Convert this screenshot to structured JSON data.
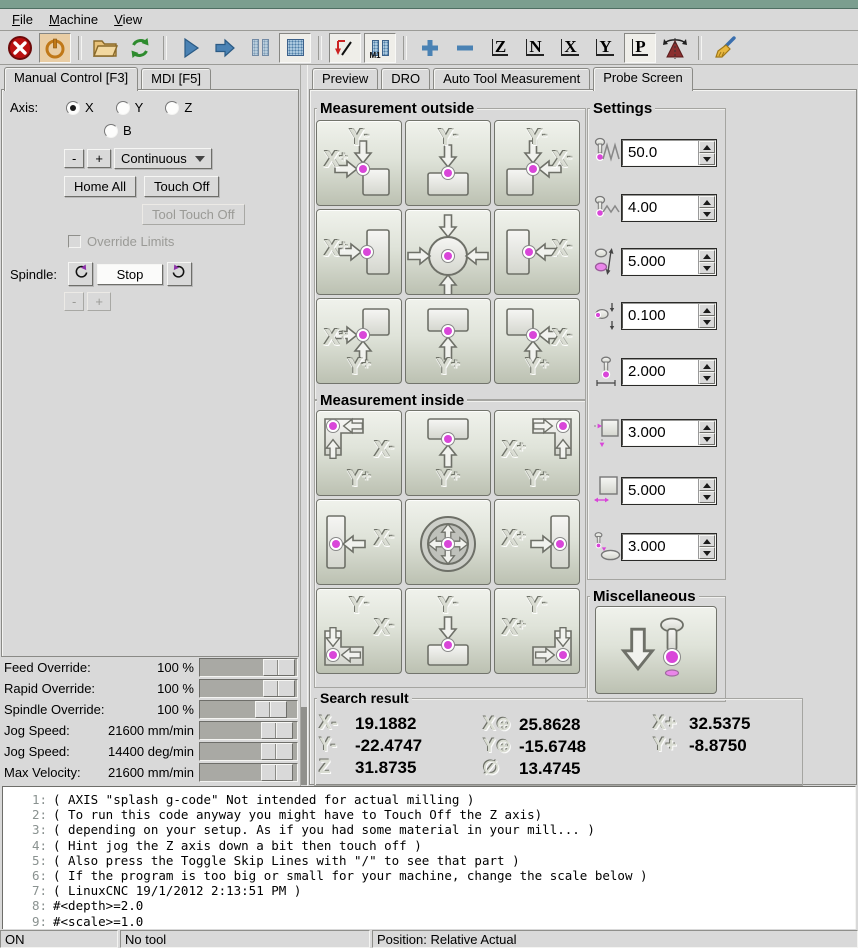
{
  "colors": {
    "titlebar_teal": "#7b9e8f",
    "toolbar_icon_blue": "#4a82b4",
    "estop_red": "#bb1111",
    "probe_dot_magenta": "#d946d9",
    "power_orange": "#c07818"
  },
  "menu": {
    "items": [
      {
        "label": "File",
        "underline": 0
      },
      {
        "label": "Machine",
        "underline": 0
      },
      {
        "label": "View",
        "underline": 0
      }
    ]
  },
  "toolbar": {
    "skip_label": "/",
    "m1_label": "M1",
    "view_letters": [
      "Z",
      "N",
      "X",
      "Y",
      "P"
    ]
  },
  "left": {
    "tabs": [
      {
        "label": "Manual Control [F3]",
        "active": true
      },
      {
        "label": "MDI [F5]",
        "active": false
      }
    ],
    "axis_label": "Axis:",
    "axes": [
      {
        "label": "X",
        "selected": true
      },
      {
        "label": "Y",
        "selected": false
      },
      {
        "label": "Z",
        "selected": false
      },
      {
        "label": "B",
        "selected": false
      }
    ],
    "jog_minus": "-",
    "jog_plus": "+",
    "jog_mode": "Continuous",
    "home_all": "Home All",
    "touch_off": "Touch Off",
    "tool_touch_off": "Tool Touch Off",
    "override_limits": "Override Limits",
    "spindle_label": "Spindle:",
    "spindle_stop": "Stop",
    "spindle_minus": "-",
    "spindle_plus": "+",
    "sliders": [
      {
        "label": "Feed Override:",
        "value": "100 %",
        "pos": 0.97
      },
      {
        "label": "Rapid Override:",
        "value": "100 %",
        "pos": 0.97
      },
      {
        "label": "Spindle Override:",
        "value": "100 %",
        "pos": 0.84
      },
      {
        "label": "Jog Speed:",
        "value": "21600 mm/min",
        "pos": 0.94
      },
      {
        "label": "Jog Speed:",
        "value": "14400 deg/min",
        "pos": 0.94
      },
      {
        "label": "Max Velocity:",
        "value": "21600 mm/min",
        "pos": 0.94
      }
    ]
  },
  "right": {
    "tabs": [
      {
        "label": "Preview",
        "active": false
      },
      {
        "label": "DRO",
        "active": false
      },
      {
        "label": "Auto Tool Measurement",
        "active": false
      },
      {
        "label": "Probe Screen",
        "active": true
      }
    ],
    "outside": {
      "title": "Measurement outside",
      "buttons": [
        {
          "name": "probe-outside-corner-xp-ym",
          "icon": "o1",
          "labels": [
            {
              "text": "Y-",
              "pos": "top"
            },
            {
              "text": "X+",
              "pos": "left"
            }
          ]
        },
        {
          "name": "probe-outside-ym",
          "icon": "o2",
          "labels": [
            {
              "text": "Y-",
              "pos": "top"
            }
          ]
        },
        {
          "name": "probe-outside-corner-xm-ym",
          "icon": "o3",
          "labels": [
            {
              "text": "Y-",
              "pos": "top"
            },
            {
              "text": "X-",
              "pos": "right"
            }
          ]
        },
        {
          "name": "probe-outside-xp",
          "icon": "o4",
          "labels": [
            {
              "text": "X+",
              "pos": "left"
            }
          ]
        },
        {
          "name": "probe-outside-center-circle",
          "icon": "o5",
          "labels": []
        },
        {
          "name": "probe-outside-xm",
          "icon": "o6",
          "labels": [
            {
              "text": "X-",
              "pos": "right"
            }
          ]
        },
        {
          "name": "probe-outside-corner-xp-yp",
          "icon": "o7",
          "labels": [
            {
              "text": "X+",
              "pos": "left"
            },
            {
              "text": "Y+",
              "pos": "bottom"
            }
          ]
        },
        {
          "name": "probe-outside-yp",
          "icon": "o8",
          "labels": [
            {
              "text": "Y+",
              "pos": "bottom"
            }
          ]
        },
        {
          "name": "probe-outside-corner-xm-yp",
          "icon": "o9",
          "labels": [
            {
              "text": "X-",
              "pos": "right"
            },
            {
              "text": "Y+",
              "pos": "bottom"
            }
          ]
        }
      ]
    },
    "inside": {
      "title": "Measurement inside",
      "buttons": [
        {
          "name": "probe-inside-corner-xm-yp",
          "icon": "i1",
          "labels": [
            {
              "text": "X-",
              "pos": "right"
            },
            {
              "text": "Y+",
              "pos": "bottom"
            }
          ]
        },
        {
          "name": "probe-inside-yp",
          "icon": "i2",
          "labels": [
            {
              "text": "Y+",
              "pos": "bottom"
            }
          ]
        },
        {
          "name": "probe-inside-corner-xp-yp",
          "icon": "i3",
          "labels": [
            {
              "text": "X+",
              "pos": "left"
            },
            {
              "text": "Y+",
              "pos": "bottom"
            }
          ]
        },
        {
          "name": "probe-inside-xm",
          "icon": "i4",
          "labels": [
            {
              "text": "X-",
              "pos": "right"
            }
          ]
        },
        {
          "name": "probe-inside-center-hole",
          "icon": "i5",
          "labels": []
        },
        {
          "name": "probe-inside-xp",
          "icon": "i6",
          "labels": [
            {
              "text": "X+",
              "pos": "left"
            }
          ]
        },
        {
          "name": "probe-inside-corner-ym-xm",
          "icon": "i7",
          "labels": [
            {
              "text": "Y-",
              "pos": "top"
            },
            {
              "text": "X-",
              "pos": "right"
            }
          ]
        },
        {
          "name": "probe-inside-ym",
          "icon": "i8",
          "labels": [
            {
              "text": "Y-",
              "pos": "top"
            }
          ]
        },
        {
          "name": "probe-inside-corner-ym-xp",
          "icon": "i9",
          "labels": [
            {
              "text": "Y-",
              "pos": "top"
            },
            {
              "text": "X+",
              "pos": "left"
            }
          ]
        }
      ]
    },
    "settings": {
      "title": "Settings",
      "rows": [
        {
          "name": "probe-feed-fast",
          "icon": "s1",
          "value": "50.0"
        },
        {
          "name": "probe-feed-slow",
          "icon": "s2",
          "value": "4.00"
        },
        {
          "name": "probe-max-distance",
          "icon": "s3",
          "value": "5.000"
        },
        {
          "name": "probe-latch-distance",
          "icon": "s4",
          "value": "0.100"
        },
        {
          "name": "probe-tip-diameter",
          "icon": "s5",
          "value": "2.000"
        },
        {
          "name": "xy-clearance",
          "icon": "s6",
          "value": "3.000"
        },
        {
          "name": "edge-length",
          "icon": "s7",
          "value": "5.000"
        },
        {
          "name": "z-clearance",
          "icon": "s8",
          "value": "3.000"
        }
      ]
    },
    "misc": {
      "title": "Miscellaneous",
      "button_name": "probe-down"
    },
    "search": {
      "title": "Search result",
      "results": [
        {
          "name": "result-x-minus",
          "glyph": "X-",
          "value": "19.1882"
        },
        {
          "name": "result-x-center",
          "glyph": "X⊕",
          "value": "25.8628"
        },
        {
          "name": "result-x-plus",
          "glyph": "X+",
          "value": "32.5375"
        },
        {
          "name": "result-y-minus",
          "glyph": "Y-",
          "value": "-22.4747"
        },
        {
          "name": "result-y-center",
          "glyph": "Y⊕",
          "value": "-15.6748"
        },
        {
          "name": "result-y-plus",
          "glyph": "Y+",
          "value": "-8.8750"
        },
        {
          "name": "result-z",
          "glyph": "Z",
          "value": "31.8735"
        },
        {
          "name": "result-diameter",
          "glyph": "∅",
          "value": "13.4745"
        }
      ]
    }
  },
  "gcode": {
    "lines": [
      {
        "n": "1:",
        "text": "( AXIS \"splash g-code\" Not intended for actual milling )"
      },
      {
        "n": "2:",
        "text": "( To run this code anyway you might have to Touch Off the Z axis)"
      },
      {
        "n": "3:",
        "text": "( depending on your setup. As if you had some material in your mill... )"
      },
      {
        "n": "4:",
        "text": "( Hint jog the Z axis down a bit then touch off )"
      },
      {
        "n": "5:",
        "text": "( Also press the Toggle Skip Lines with \"/\" to see that part )"
      },
      {
        "n": "6:",
        "text": "( If the program is too big or small for your machine, change the scale below )"
      },
      {
        "n": "7:",
        "text": "( LinuxCNC 19/1/2012 2:13:51 PM )"
      },
      {
        "n": "8:",
        "text": "#<depth>=2.0"
      },
      {
        "n": "9:",
        "text": "#<scale>=1.0"
      }
    ]
  },
  "status": {
    "cells": [
      "ON",
      "No tool",
      "Position: Relative Actual"
    ]
  }
}
